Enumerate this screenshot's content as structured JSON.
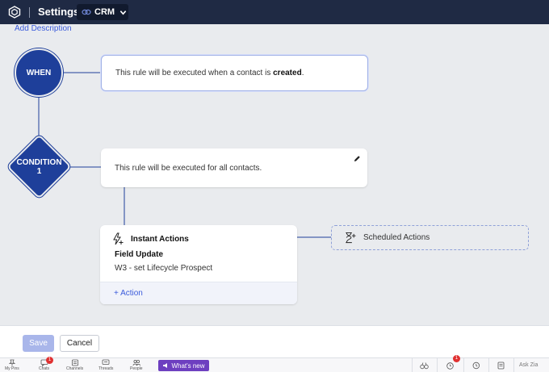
{
  "header": {
    "title": "Settings",
    "module": "CRM",
    "colors": {
      "bar": "#1f2a44",
      "pill": "#111a2e"
    }
  },
  "canvas": {
    "add_description": "Add Description",
    "when": {
      "label": "WHEN",
      "text_prefix": "This rule will be executed when a contact is ",
      "text_bold": "created",
      "text_suffix": "."
    },
    "condition": {
      "label": "CONDITION",
      "number": "1",
      "text": "This rule will be executed for all contacts."
    },
    "instant_actions": {
      "title": "Instant Actions",
      "field_update_title": "Field Update",
      "field_update_value": "W3 - set Lifecycle Prospect",
      "add_action": "+ Action"
    },
    "scheduled_actions": {
      "title": "Scheduled Actions"
    },
    "colors": {
      "node": "#1e3f9a",
      "link": "#3b5bdb"
    }
  },
  "footer": {
    "save": "Save",
    "cancel": "Cancel"
  },
  "bottombar": {
    "items": [
      {
        "label": "My Pins",
        "icon": "pin-icon"
      },
      {
        "label": "Chats",
        "icon": "chat-icon",
        "badge": "1"
      },
      {
        "label": "Channels",
        "icon": "channels-icon"
      },
      {
        "label": "Threads",
        "icon": "threads-icon"
      },
      {
        "label": "People",
        "icon": "people-icon"
      }
    ],
    "whats_new": "What's new",
    "alarm_badge": "1",
    "ask_zia": "Ask Zia"
  }
}
